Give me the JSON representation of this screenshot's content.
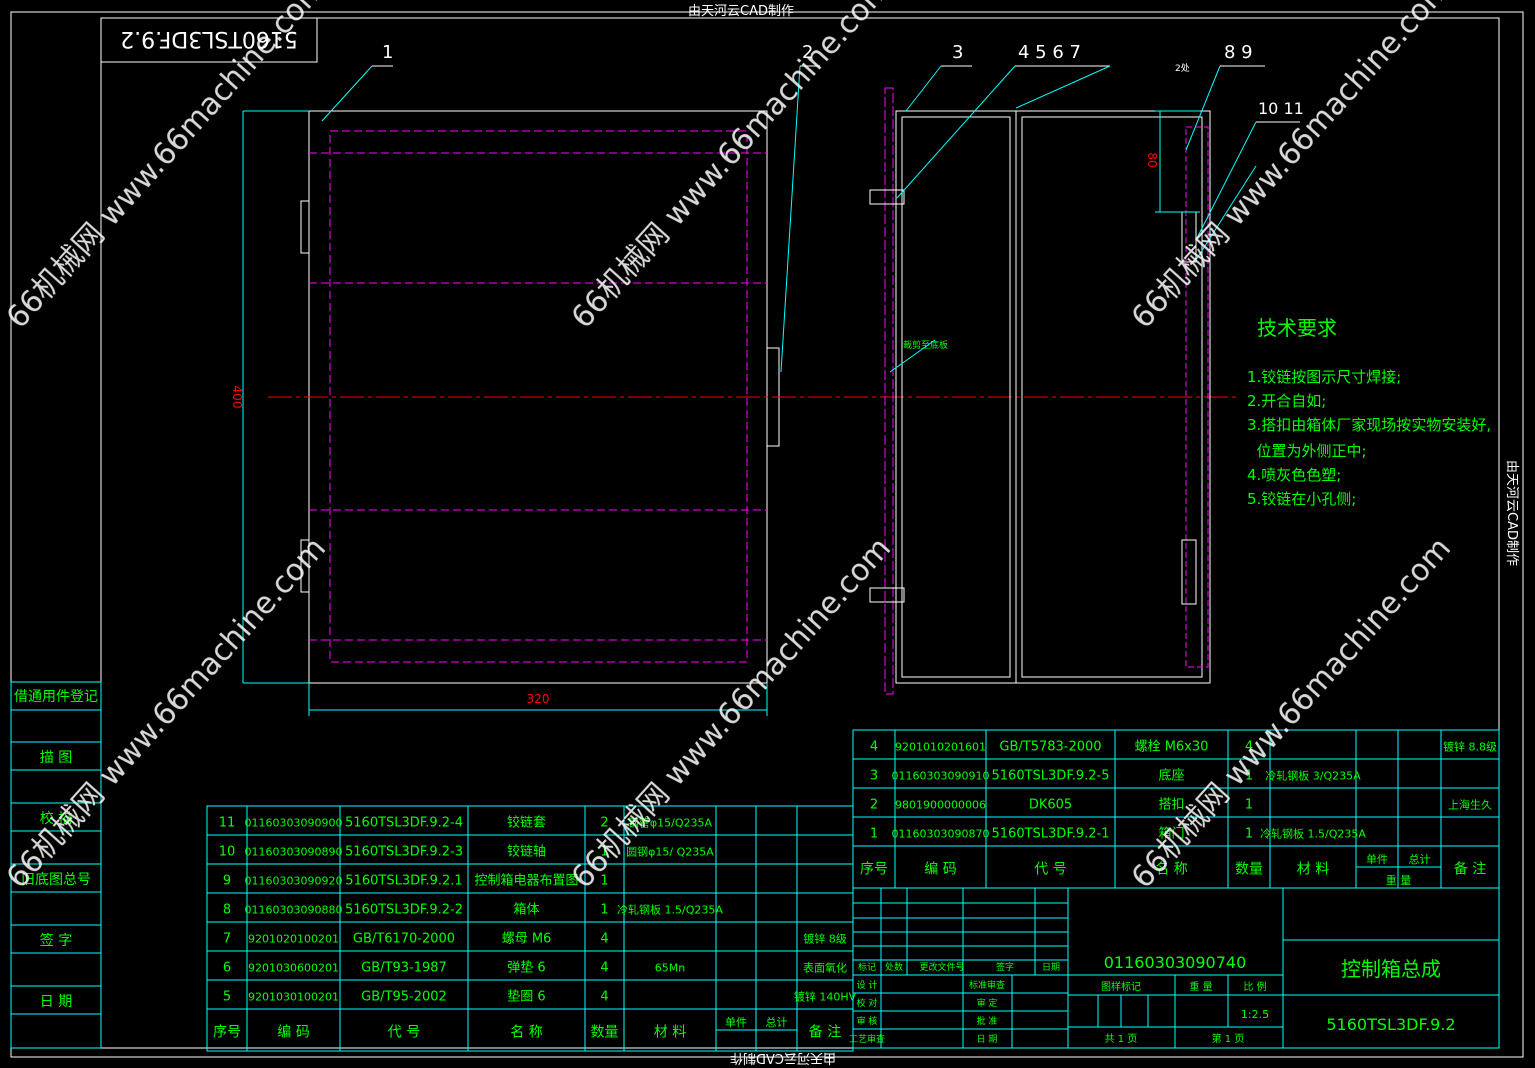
{
  "watermark_top": "由天河云CAD制作",
  "watermark_bottom": "由天河云CAD制作",
  "watermark_side": "由天河云CAD制作",
  "drawing_code_mirror": "5160TSL3DF.9.2",
  "overlay_watermark": "66机械网 www.66machine.com",
  "balloons": [
    "1",
    "2",
    "3",
    "4  5  6  7",
    "8  9",
    "10  11"
  ],
  "weld_note": "2处",
  "dimensions": {
    "height": "400",
    "width": "320",
    "hinge_offset": "80"
  },
  "section_label": "裁剪至底板",
  "tech_requirements": {
    "title": "技术要求",
    "items": [
      "1.铰链按图示尺寸焊接;",
      "2.开合自如;",
      "3.搭扣由箱体厂家现场按实物安装好,",
      "  位置为外侧正中;",
      "4.喷灰色色塑;",
      "5.铰链在小孔侧;"
    ]
  },
  "left_strip": [
    "借通用件登记",
    "描 图",
    "校 描",
    "旧底图总号",
    "签 字",
    "日 期"
  ],
  "bom_left": {
    "rows": [
      [
        "11",
        "01160303090900",
        "5160TSL3DF.9.2-4",
        "铰链套",
        "2",
        "钢管φ15/Q235A",
        "",
        "",
        ""
      ],
      [
        "10",
        "01160303090890",
        "5160TSL3DF.9.2-3",
        "铰链轴",
        "1",
        "圆钢φ15/ Q235A",
        "",
        "",
        ""
      ],
      [
        "9",
        "01160303090920",
        "5160TSL3DF.9.2.1",
        "控制箱电器布置图",
        "1",
        "",
        "",
        "",
        ""
      ],
      [
        "8",
        "01160303090880",
        "5160TSL3DF.9.2-2",
        "箱体",
        "1",
        "冷轧钢板 1.5/Q235A",
        "",
        "",
        ""
      ],
      [
        "7",
        "9201020100201",
        "GB/T6170-2000",
        "螺母 M6",
        "4",
        "",
        "",
        "",
        "镀锌 8级"
      ],
      [
        "6",
        "9201030600201",
        "GB/T93-1987",
        "弹垫 6",
        "4",
        "65Mn",
        "",
        "",
        "表面氧化"
      ],
      [
        "5",
        "9201030100201",
        "GB/T95-2002",
        "垫圈 6",
        "4",
        "",
        "",
        "",
        "镀锌 140HV"
      ]
    ],
    "header": [
      "序号",
      "编  码",
      "代  号",
      "名  称",
      "数量",
      "材  料",
      "单件",
      "总计",
      "备 注"
    ]
  },
  "bom_right": {
    "rows": [
      [
        "4",
        "9201010201601",
        "GB/T5783-2000",
        "螺栓 M6x30",
        "4",
        "",
        "",
        "",
        "镀锌 8.8级"
      ],
      [
        "3",
        "01160303090910",
        "5160TSL3DF.9.2-5",
        "底座",
        "1",
        "冷轧钢板 3/Q235A",
        "",
        "",
        ""
      ],
      [
        "2",
        "9801900000006",
        "DK605",
        "搭扣",
        "1",
        "",
        "",
        "",
        "上海生久"
      ],
      [
        "1",
        "01160303090870",
        "5160TSL3DF.9.2-1",
        "箱门",
        "1",
        "冷轧钢板 1.5/Q235A",
        "",
        "",
        ""
      ]
    ],
    "header": [
      "序号",
      "编  码",
      "代  号",
      "名  称",
      "数量",
      "材  料",
      "单件",
      "总计",
      "备  注"
    ],
    "header_sub": "重  量"
  },
  "title_block": {
    "rev_labels": [
      "标记",
      "处数",
      "更改文件号",
      "签字",
      "日期"
    ],
    "role_labels": [
      "设 计",
      "校 对",
      "审 核",
      "工艺审查"
    ],
    "approval_labels": [
      "标准审查",
      "审 定",
      "批 准",
      "日 期"
    ],
    "code": "01160303090740",
    "stage_label": "图样标记",
    "weight_label": "重  量",
    "scale_label": "比 例",
    "scale": "1:2.5",
    "sheets_total": "共 1 页",
    "sheet_no": "第 1 页",
    "name": "控制箱总成",
    "drawing_no": "5160TSL3DF.9.2"
  },
  "colors": {
    "outline": "#ffffff",
    "hidden": "#ff00ff",
    "center": "#ff0000",
    "leader": "#00ffff",
    "text": "#00ff00",
    "grid": "#00ffff",
    "watermark": "#ffffff"
  }
}
